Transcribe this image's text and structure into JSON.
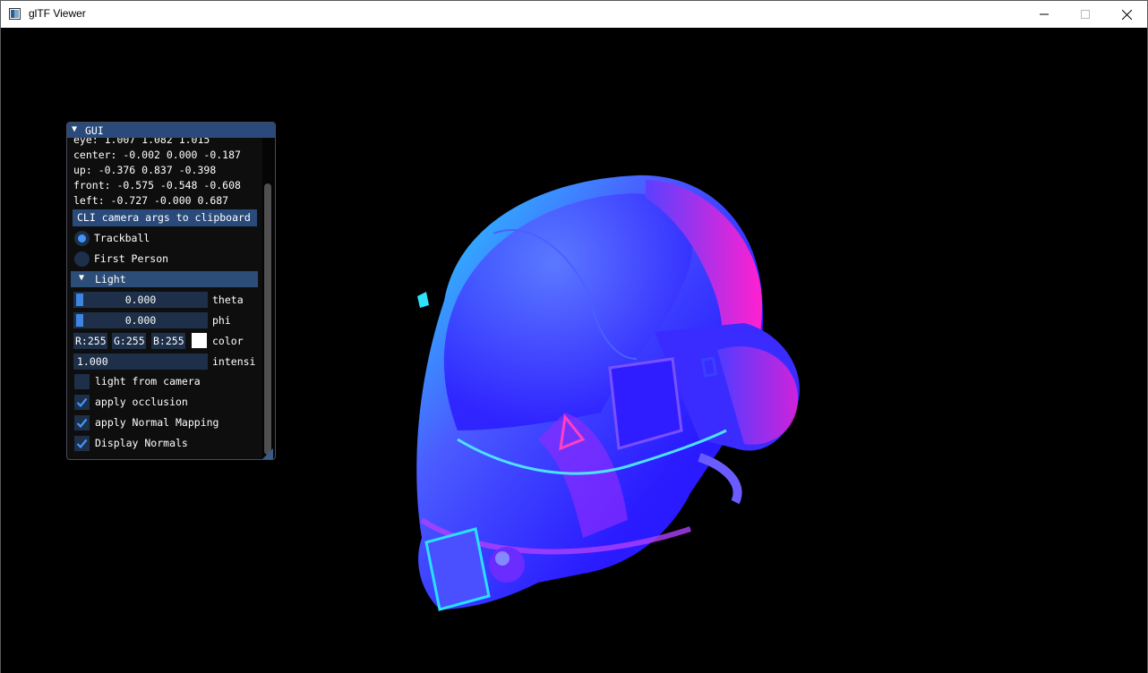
{
  "window": {
    "title": "glTF Viewer"
  },
  "gui": {
    "title": "GUI",
    "camera": {
      "eye": "eye: 1.007 1.082 1.015",
      "center": "center: -0.002 0.000 -0.187",
      "up": "up: -0.376 0.837 -0.398",
      "front": "front: -0.575 -0.548 -0.608",
      "left": "left: -0.727 -0.000 0.687",
      "copy_button": "CLI camera args to clipboard"
    },
    "camera_modes": [
      {
        "label": "Trackball",
        "selected": true
      },
      {
        "label": "First Person",
        "selected": false
      }
    ],
    "light": {
      "header": "Light",
      "theta": {
        "value": "0.000",
        "label": "theta"
      },
      "phi": {
        "value": "0.000",
        "label": "phi"
      },
      "color": {
        "r": "R:255",
        "g": "G:255",
        "b": "B:255",
        "label": "color",
        "swatch": "#ffffff"
      },
      "intensity": {
        "value": "1.000",
        "label": "intensi"
      }
    },
    "checkboxes": [
      {
        "label": "light from camera",
        "checked": false
      },
      {
        "label": "apply occlusion",
        "checked": true
      },
      {
        "label": "apply Normal Mapping",
        "checked": true
      },
      {
        "label": "Display Normals",
        "checked": true
      }
    ]
  },
  "colors": {
    "accent": "#4296fa",
    "title_bar": "#294a7a",
    "frame_bg": "#1d2f49"
  }
}
